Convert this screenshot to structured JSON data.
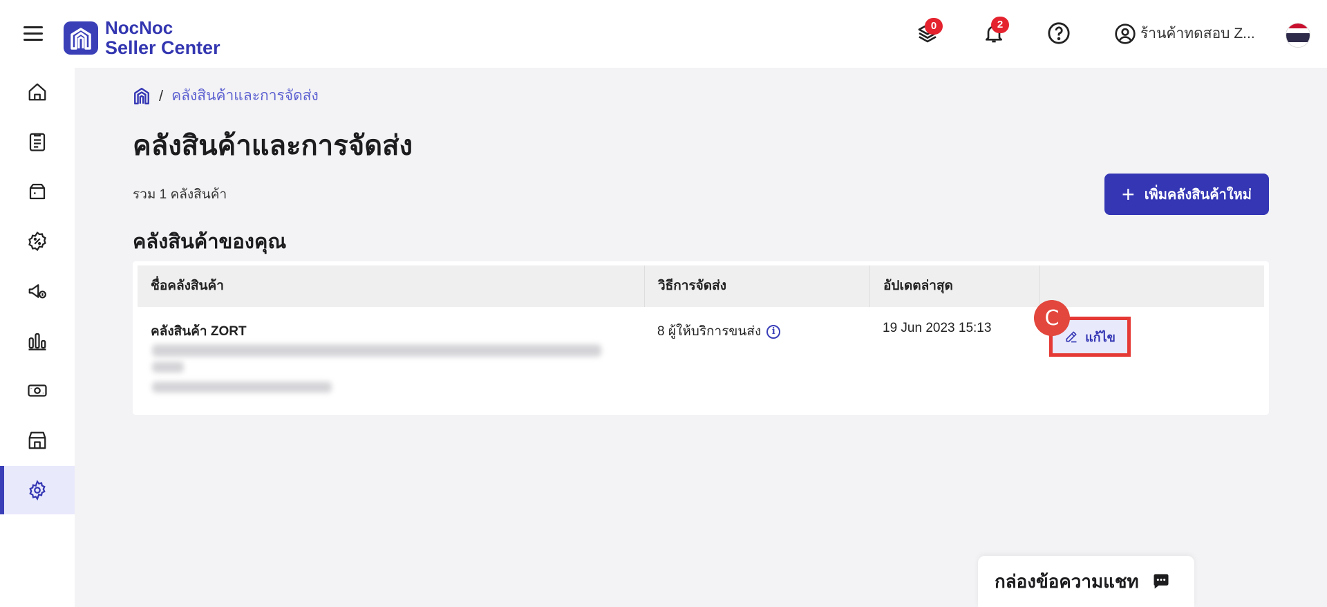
{
  "header": {
    "brand_line1": "NocNoc",
    "brand_line2": "Seller Center",
    "tasks_badge": "0",
    "notifications_badge": "2",
    "store_name": "ร้านค้าทดสอบ Z..."
  },
  "sidebar": {
    "items": [
      {
        "icon": "home-icon"
      },
      {
        "icon": "orders-icon"
      },
      {
        "icon": "products-icon"
      },
      {
        "icon": "promotion-icon"
      },
      {
        "icon": "marketing-icon"
      },
      {
        "icon": "analytics-icon"
      },
      {
        "icon": "finance-icon"
      },
      {
        "icon": "shop-icon"
      },
      {
        "icon": "settings-icon",
        "active": true
      }
    ]
  },
  "breadcrumb": {
    "separator": "/",
    "current": "คลังสินค้าและการจัดส่ง"
  },
  "page": {
    "title": "คลังสินค้าและการจัดส่ง",
    "total_text": "รวม 1 คลังสินค้า",
    "add_button": "เพิ่มคลังสินค้าใหม่",
    "section_title": "คลังสินค้าของคุณ"
  },
  "table": {
    "columns": [
      "ชื่อคลังสินค้า",
      "วิธีการจัดส่ง",
      "อัปเดตล่าสุด",
      ""
    ],
    "rows": [
      {
        "name": "คลังสินค้า ZORT",
        "shipping": "8 ผู้ให้บริการขนส่ง",
        "updated": "19 Jun 2023 15:13",
        "action": "แก้ไข"
      }
    ]
  },
  "annotation_marker": "C",
  "chat": {
    "label": "กล่องข้อความแชท"
  },
  "colors": {
    "brand": "#3436b4",
    "highlight": "#e53935",
    "badge": "#e4232f"
  }
}
